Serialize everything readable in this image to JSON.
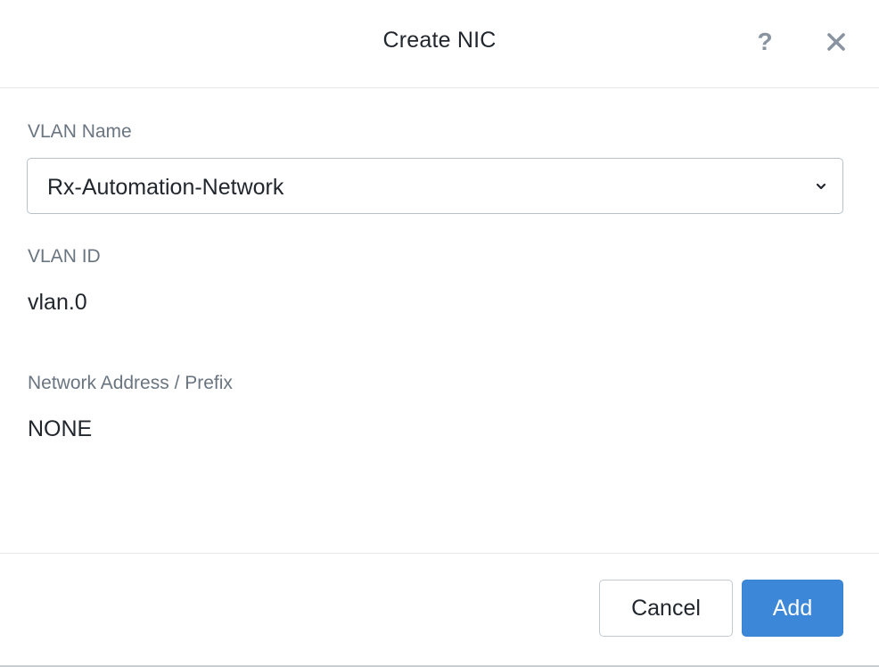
{
  "dialog": {
    "title": "Create NIC",
    "help_glyph": "?",
    "help_icon": "question-mark-icon",
    "close_icon": "close-icon"
  },
  "form": {
    "vlan_name": {
      "label": "VLAN Name",
      "selected": "Rx-Automation-Network",
      "chevron_icon": "chevron-down-icon"
    },
    "vlan_id": {
      "label": "VLAN ID",
      "value": "vlan.0"
    },
    "network_address": {
      "label": "Network Address / Prefix",
      "value": "NONE"
    }
  },
  "footer": {
    "cancel_label": "Cancel",
    "add_label": "Add"
  },
  "colors": {
    "primary": "#3d87d9",
    "label": "#6a7581",
    "text": "#22272e",
    "icon": "#8a94a0"
  }
}
